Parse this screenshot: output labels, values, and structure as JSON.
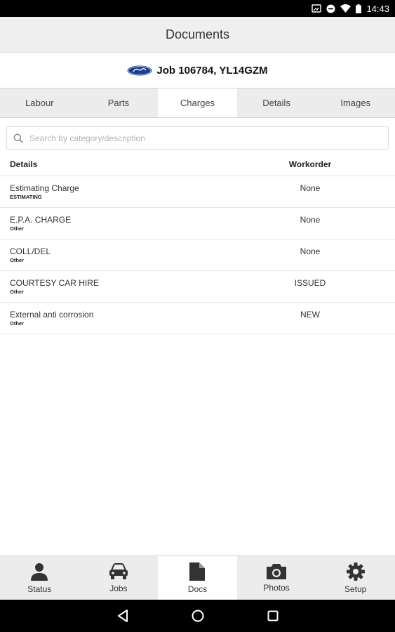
{
  "status_bar": {
    "time": "14:43"
  },
  "header": {
    "title": "Documents"
  },
  "job": {
    "title": "Job 106784, YL14GZM"
  },
  "tabs": [
    {
      "label": "Labour"
    },
    {
      "label": "Parts"
    },
    {
      "label": "Charges"
    },
    {
      "label": "Details"
    },
    {
      "label": "Images"
    }
  ],
  "active_tab": "Charges",
  "search": {
    "placeholder": "Search by category/description",
    "value": ""
  },
  "table": {
    "headers": {
      "details": "Details",
      "workorder": "Workorder"
    },
    "rows": [
      {
        "title": "Estimating Charge",
        "category": "ESTIMATING",
        "workorder": "None"
      },
      {
        "title": "E.P.A. CHARGE",
        "category": "Other",
        "workorder": "None"
      },
      {
        "title": "COLL/DEL",
        "category": "Other",
        "workorder": "None"
      },
      {
        "title": "COURTESY CAR HIRE",
        "category": "Other",
        "workorder": "ISSUED"
      },
      {
        "title": "External anti corrosion",
        "category": "Other",
        "workorder": "NEW"
      }
    ]
  },
  "bottom_nav": [
    {
      "label": "Status",
      "icon": "person-icon"
    },
    {
      "label": "Jobs",
      "icon": "car-icon"
    },
    {
      "label": "Docs",
      "icon": "document-icon"
    },
    {
      "label": "Photos",
      "icon": "camera-icon"
    },
    {
      "label": "Setup",
      "icon": "gear-icon"
    }
  ],
  "active_nav": "Docs",
  "colors": {
    "icon_dark": "#333333",
    "brand_blue": "#1d3f8a"
  }
}
